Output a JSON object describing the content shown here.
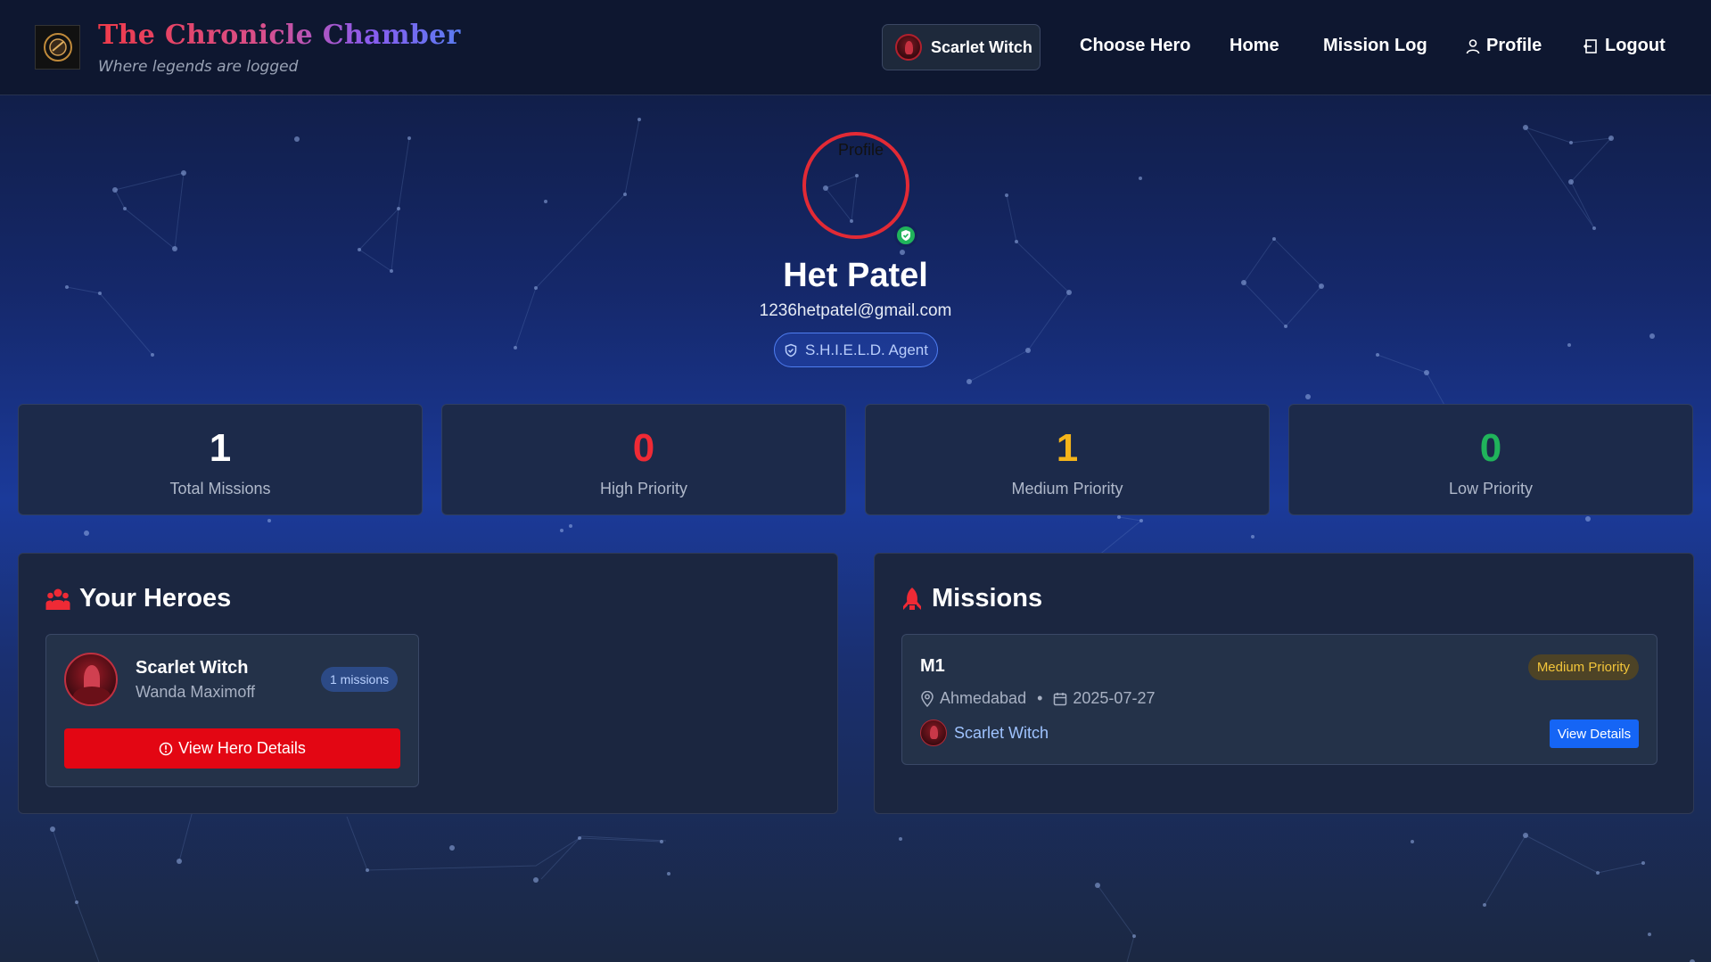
{
  "app": {
    "title": "The Chronicle Chamber",
    "tagline": "Where legends are logged",
    "colors": {
      "accent_red": "#e22a35",
      "high_priority": "#ef2a35",
      "medium_priority": "#f4b41a",
      "low_priority": "#20b45b",
      "primary_button": "#1565f5",
      "hero_button": "#e30613"
    }
  },
  "nav": {
    "active_hero": "Scarlet Witch",
    "links": {
      "choose_hero": "Choose Hero",
      "home": "Home",
      "mission_log": "Mission Log",
      "profile": "Profile",
      "logout": "Logout"
    },
    "icons": {
      "profile": "user-icon",
      "logout": "logout-icon"
    }
  },
  "profile": {
    "avatar_alt": "Profile",
    "name": "Het Patel",
    "email": "1236hetpatel@gmail.com",
    "role": "S.H.I.E.L.D. Agent",
    "verified_icon": "shield-check-icon"
  },
  "stats": [
    {
      "value": "1",
      "label": "Total Missions",
      "color": "#ffffff"
    },
    {
      "value": "0",
      "label": "High Priority",
      "color": "#ef2a35"
    },
    {
      "value": "1",
      "label": "Medium Priority",
      "color": "#f4b41a"
    },
    {
      "value": "0",
      "label": "Low Priority",
      "color": "#20b45b"
    }
  ],
  "heroes_panel": {
    "title": "Your Heroes",
    "icon": "users-icon",
    "heroes": [
      {
        "name": "Scarlet Witch",
        "alias": "Wanda Maximoff",
        "missions": "1 missions",
        "button_label": "View Hero Details"
      }
    ]
  },
  "missions_panel": {
    "title": "Missions",
    "icon": "rocket-icon",
    "missions": [
      {
        "name": "M1",
        "priority": "Medium Priority",
        "location": "Ahmedabad",
        "separator": "•",
        "date": "2025-07-27",
        "hero": "Scarlet Witch",
        "button_label": "View Details"
      }
    ]
  }
}
